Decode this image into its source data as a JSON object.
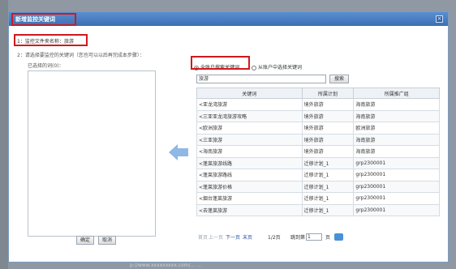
{
  "background_text": "p://www.xxxxxxxxx.com/... ...",
  "dialog": {
    "title": "新增监控关键词",
    "close_label": "×"
  },
  "step1": {
    "label": "1：监控文件夹名称：",
    "value": "旅游"
  },
  "step2": {
    "label": "2：请选择要监控的关键词（您也可以以后再完成本步骤）："
  },
  "selected": {
    "label": "已选择的词(0)："
  },
  "source": {
    "option_all": "全账户搜索关键词",
    "option_account": "从账户中选择关键词"
  },
  "search": {
    "value": "旅游",
    "button": "搜索"
  },
  "table": {
    "headers": [
      "关键词",
      "所属计划",
      "所属推广组"
    ],
    "rows": [
      [
        "<亚龙湾旅游",
        "境外旅游",
        "海南旅游"
      ],
      [
        "<三亚亚龙湾旅游攻略",
        "境外旅游",
        "海南旅游"
      ],
      [
        "<欧洲旅游",
        "境外旅游",
        "欧洲旅游"
      ],
      [
        "<三亚旅游",
        "境外旅游",
        "海南旅游"
      ],
      [
        "<海南旅游",
        "境外旅游",
        "海南旅游"
      ],
      [
        "<蓬莱旅游线路",
        "迁移计划_1",
        "grp2300001"
      ],
      [
        "<蓬莱旅游路线",
        "迁移计划_1",
        "grp2300001"
      ],
      [
        "<蓬莱旅游价格",
        "迁移计划_1",
        "grp2300001"
      ],
      [
        "<烟台蓬莱旅游",
        "迁移计划_1",
        "grp2300001"
      ],
      [
        "<去蓬莱旅游",
        "迁移计划_1",
        "grp2300001"
      ]
    ]
  },
  "pager": {
    "first": "首页",
    "prev": "上一页",
    "next": "下一页",
    "last": "末页",
    "page_info": "1/2页",
    "jump_label": "跳到第",
    "jump_value": "1",
    "page_suffix": "页"
  },
  "buttons": {
    "ok": "确定",
    "cancel": "取消"
  },
  "colors": {
    "title_bar": "#3a6fb4",
    "highlight": "#d0191f",
    "arrow": "#8fb8e6",
    "link": "#1f4fa0"
  }
}
